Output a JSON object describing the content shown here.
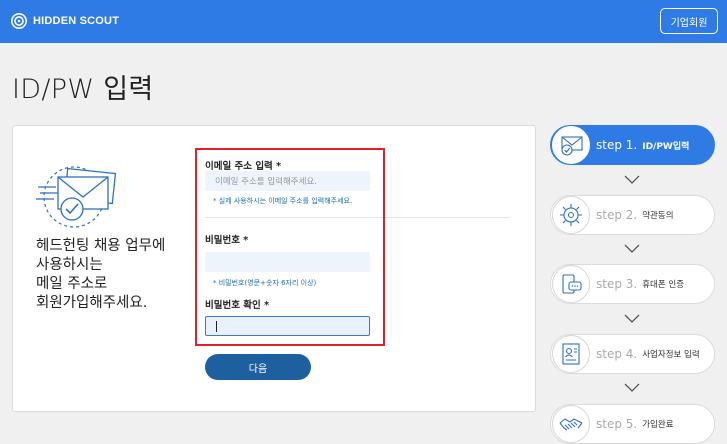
{
  "header": {
    "logo_text": "HIDDEN SCOUT",
    "corporate_button": "기업회원",
    "brand_color": "#2f7be6"
  },
  "page": {
    "title": "ID/PW 입력"
  },
  "promo": {
    "lines": [
      "헤드헌팅 채용 업무에",
      "사용하시는",
      "메일 주소로",
      "회원가입해주세요."
    ]
  },
  "form": {
    "email": {
      "label": "이메일 주소 입력",
      "required_mark": "*",
      "placeholder": "이메일 주소를 입력해주세요.",
      "value": "",
      "hint": "* 실제 사용하시는 이메일 주소를 입력해주세요."
    },
    "password": {
      "label": "비밀번호",
      "required_mark": "*",
      "value": "",
      "hint": "* 비밀번호(영문+숫자 6자리 이상)"
    },
    "password_confirm": {
      "label": "비밀번호 확인",
      "required_mark": "*",
      "value": ""
    },
    "next_button": "다음"
  },
  "steps": [
    {
      "num": "step 1.",
      "name": "ID/PW입력",
      "active": true,
      "icon": "mail-check-icon"
    },
    {
      "num": "step 2.",
      "name": "약관동의",
      "active": false,
      "icon": "gear-cog-icon"
    },
    {
      "num": "step 3.",
      "name": "휴대폰 인증",
      "active": false,
      "icon": "phone-chat-icon"
    },
    {
      "num": "step 4.",
      "name": "사업자정보 입력",
      "active": false,
      "icon": "business-id-icon"
    },
    {
      "num": "step 5.",
      "name": "가입완료",
      "active": false,
      "icon": "handshake-icon"
    }
  ],
  "colors": {
    "accent": "#2f7be6",
    "button": "#1e5fa0",
    "hint": "#1b6fb0",
    "highlight": "#e0202a"
  }
}
